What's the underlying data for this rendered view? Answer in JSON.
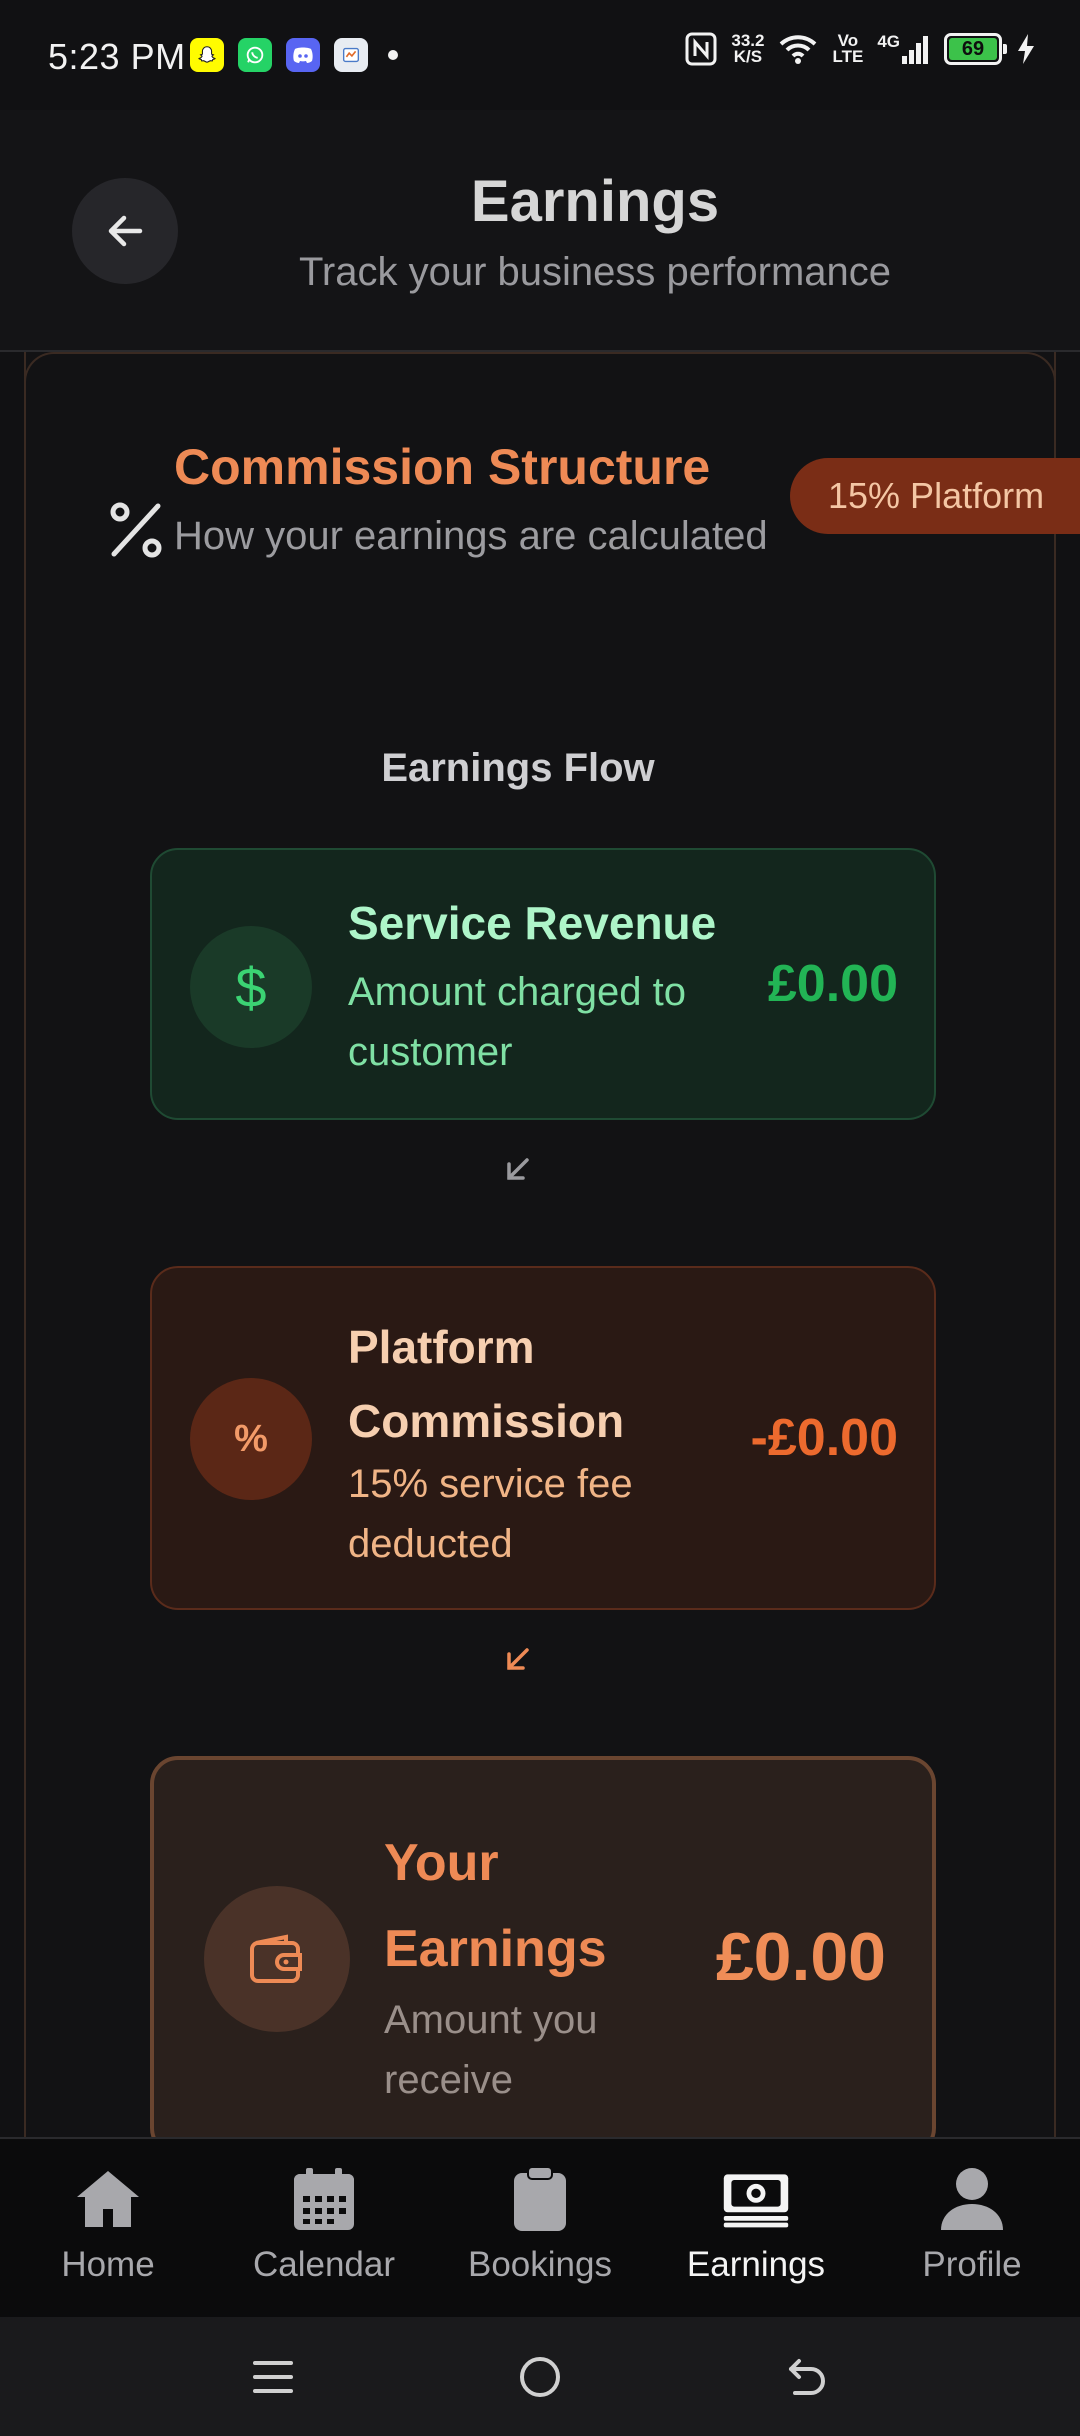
{
  "status_bar": {
    "time": "5:23 PM",
    "net_speed_value": "33.2",
    "net_speed_unit": "K/S",
    "volte_top": "Vo",
    "volte_bottom": "LTE",
    "network_type": "4G",
    "battery_level": "69"
  },
  "header": {
    "title": "Earnings",
    "subtitle": "Track your business performance"
  },
  "commission": {
    "title": "Commission Structure",
    "subtitle": "How your earnings are calculated",
    "badge": "15% Platform"
  },
  "flow": {
    "title": "Earnings Flow",
    "revenue": {
      "icon_glyph": "$",
      "title": "Service Revenue",
      "desc": "Amount charged to customer",
      "amount": "£0.00"
    },
    "commission": {
      "icon_glyph": "%",
      "title": "Platform Commission",
      "desc": "15% service fee deducted",
      "amount": "-£0.00"
    },
    "earnings": {
      "title": "Your Earnings",
      "desc": "Amount you receive",
      "amount": "£0.00"
    }
  },
  "bottom_nav": {
    "items": [
      {
        "label": "Home",
        "icon": "home-icon"
      },
      {
        "label": "Calendar",
        "icon": "calendar-icon"
      },
      {
        "label": "Bookings",
        "icon": "clipboard-icon"
      },
      {
        "label": "Earnings",
        "icon": "money-icon",
        "active": true
      },
      {
        "label": "Profile",
        "icon": "user-icon"
      }
    ]
  },
  "colors": {
    "accent": "#ee8a55",
    "revenue_green": "#22b455",
    "commission_red": "#ec6a2e",
    "background": "#111113"
  }
}
